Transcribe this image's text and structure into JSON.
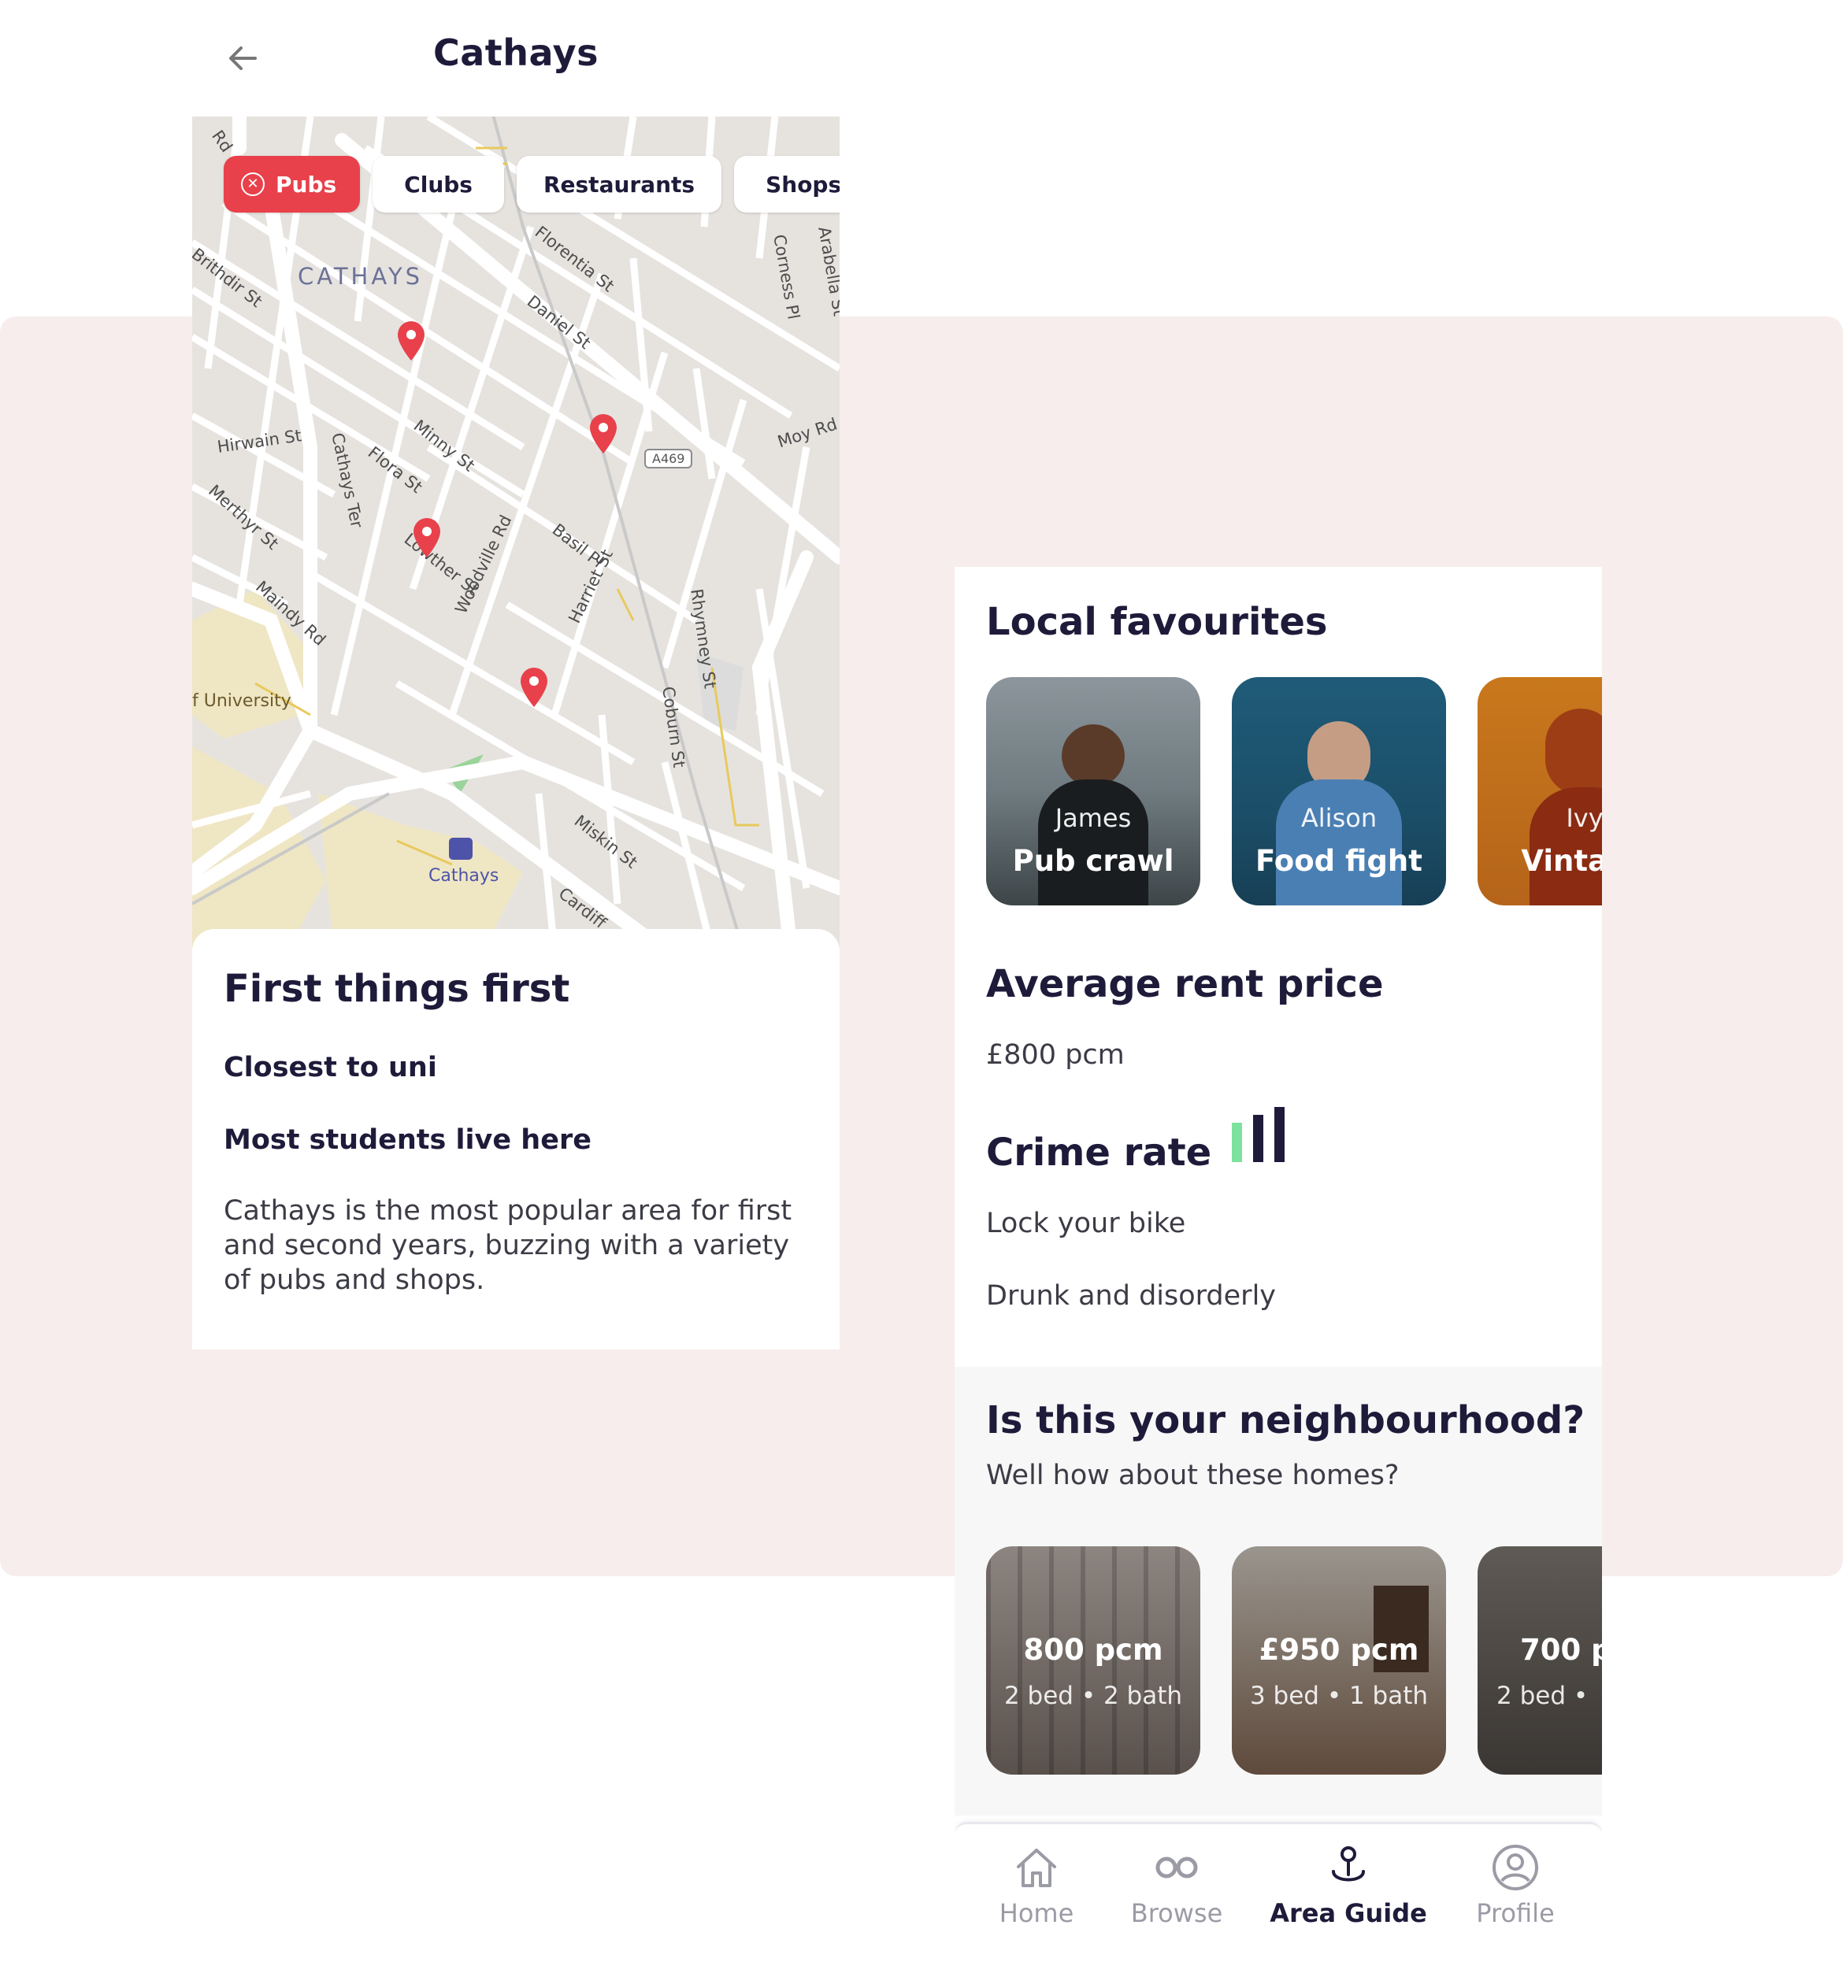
{
  "header": {
    "title": "Cathays",
    "back_icon": "arrow-left-icon"
  },
  "map": {
    "filters": [
      {
        "label": "Pubs",
        "active": true
      },
      {
        "label": "Clubs",
        "active": false
      },
      {
        "label": "Restaurants",
        "active": false
      },
      {
        "label": "Shops",
        "active": false
      }
    ],
    "area_label": "CATHAYS",
    "road_shield": "A469",
    "uni_label": "f University",
    "station_label": "Cathays",
    "street_labels": [
      "Rd",
      "Brithdir St",
      "Hirwain St",
      "Merthyr St",
      "Maindy Rd",
      "Cathays Ter",
      "Flora St",
      "Minny St",
      "Daniel St",
      "Florentia St",
      "Basil Pl",
      "Harriet St",
      "Woodville Rd",
      "Lowther St",
      "Rhymney St",
      "Coburn St",
      "Miskin St",
      "Cardiff",
      "Moy Rd",
      "Corness Pl",
      "Arabella St"
    ],
    "pin_color": "#e8414b",
    "accent_color": "#e8414b"
  },
  "first_things": {
    "title": "First things first",
    "point1": "Closest to uni",
    "point2": "Most students live here",
    "description": "Cathays is the most popular area for first and second years, buzzing with a variety of pubs and shops."
  },
  "local_favourites": {
    "title": "Local favourites",
    "items": [
      {
        "name": "James",
        "activity": "Pub crawl"
      },
      {
        "name": "Alison",
        "activity": "Food fight"
      },
      {
        "name": "Ivy",
        "activity": "Vintage"
      }
    ]
  },
  "rent": {
    "title": "Average rent price",
    "value": "£800 pcm"
  },
  "crime": {
    "title": "Crime rate",
    "level_fraction": 0.33,
    "colors": {
      "low": "#7de29d",
      "high": "#1e1b3a"
    },
    "notes": [
      "Lock your bike",
      "Drunk and disorderly"
    ]
  },
  "neighbourhood": {
    "title": "Is this your neighbourhood?",
    "subtitle": "Well how about these homes?",
    "homes": [
      {
        "price": "800 pcm",
        "meta": "2 bed  •  2 bath"
      },
      {
        "price": "£950 pcm",
        "meta": "3 bed  •  1 bath"
      },
      {
        "price": "700 p",
        "meta": "2 bed  •"
      }
    ]
  },
  "nav": {
    "items": [
      {
        "label": "Home",
        "icon": "home-icon",
        "active": false
      },
      {
        "label": "Browse",
        "icon": "browse-icon",
        "active": false
      },
      {
        "label": "Area Guide",
        "icon": "area-guide-icon",
        "active": true
      },
      {
        "label": "Profile",
        "icon": "profile-icon",
        "active": false
      }
    ]
  },
  "colors": {
    "background_band": "#f7eded",
    "text_primary": "#1e1b3a",
    "accent": "#e8414b"
  }
}
